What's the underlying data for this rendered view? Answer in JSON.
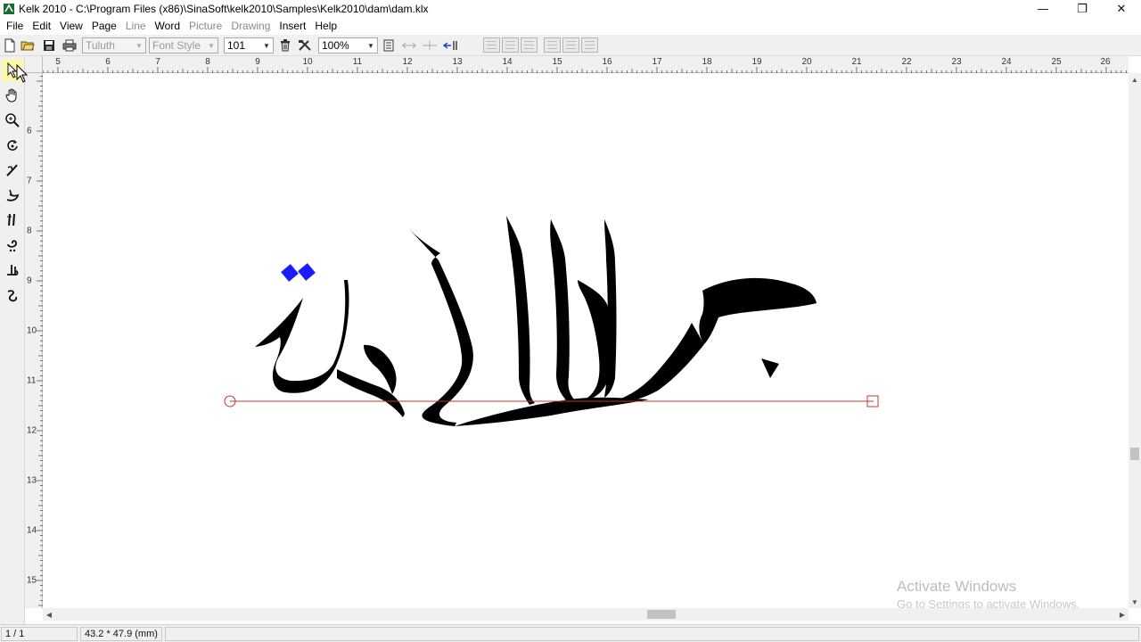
{
  "window": {
    "title": "Kelk 2010 - C:\\Program Files (x86)\\SinaSoft\\kelk2010\\Samples\\Kelk2010\\dam\\dam.klx",
    "minimize": "—",
    "restore": "❐",
    "close": "✕"
  },
  "menu": {
    "items": [
      {
        "label": "File",
        "enabled": true
      },
      {
        "label": "Edit",
        "enabled": true
      },
      {
        "label": "View",
        "enabled": true
      },
      {
        "label": "Page",
        "enabled": true
      },
      {
        "label": "Line",
        "enabled": false
      },
      {
        "label": "Word",
        "enabled": true
      },
      {
        "label": "Picture",
        "enabled": false
      },
      {
        "label": "Drawing",
        "enabled": false
      },
      {
        "label": "Insert",
        "enabled": true
      },
      {
        "label": "Help",
        "enabled": true
      }
    ]
  },
  "toolbar": {
    "font_value": "Tuluth",
    "font_style_value": "Font Style",
    "size_value": "101",
    "zoom_value": "100%"
  },
  "rulers": {
    "horizontal": [
      "5",
      "6",
      "7",
      "8",
      "9",
      "10",
      "11",
      "12",
      "13",
      "14",
      "15",
      "16",
      "17",
      "18",
      "19",
      "20",
      "21",
      "22",
      "23",
      "24",
      "25",
      "26"
    ],
    "vertical": [
      "6",
      "7",
      "8",
      "9",
      "10",
      "11",
      "12",
      "13",
      "14",
      "15"
    ]
  },
  "canvas": {
    "calligraphy_text": "جود الأئمة",
    "baseline_color": "#c0392b",
    "ink_color": "#000000",
    "dots_color": "#1a1aff"
  },
  "status": {
    "page": "1 / 1",
    "dimensions": "43.2 * 47.9 (mm)"
  },
  "watermark": {
    "title": "Activate Windows",
    "subtitle": "Go to Settings to activate Windows."
  }
}
